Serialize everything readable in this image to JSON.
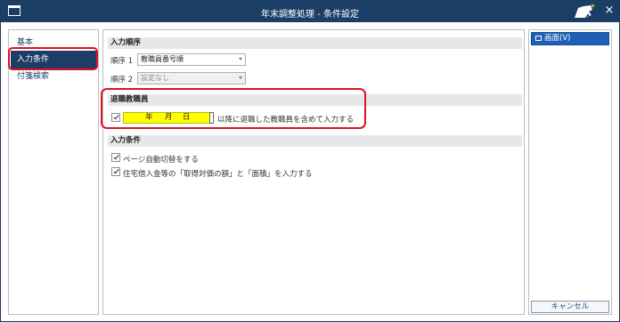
{
  "window": {
    "title": "年末調整処理 - 条件設定"
  },
  "sidebar": {
    "items": [
      {
        "label": "基本"
      },
      {
        "label": "入力条件"
      },
      {
        "label": "付箋検索"
      }
    ],
    "active_index": 1
  },
  "main": {
    "input_order": {
      "header": "入力順序",
      "order1_label": "順序 1",
      "order1_value": "教職員番号順",
      "order2_label": "順序 2",
      "order2_value": "設定なし"
    },
    "retired": {
      "header": "退職教職員",
      "checked": true,
      "date_year": "年",
      "date_month": "月",
      "date_day": "日",
      "suffix_text": "以降に退職した教職員を含めて入力する"
    },
    "input_conditions": {
      "header": "入力条件",
      "options": [
        {
          "label": "ページ自動切替をする",
          "checked": true
        },
        {
          "label": "住宅借入金等の「取得対価の額」と「面積」を入力する",
          "checked": true
        }
      ]
    }
  },
  "right_panel": {
    "view_button_label": "画面(V)",
    "cancel_button_label": "キャンセル"
  },
  "colors": {
    "titlebar": "#1b3e66",
    "active_item": "#1d3d66",
    "highlight_box": "#e0101f",
    "date_fill": "#ffff00",
    "primary_button": "#1d60b8"
  }
}
